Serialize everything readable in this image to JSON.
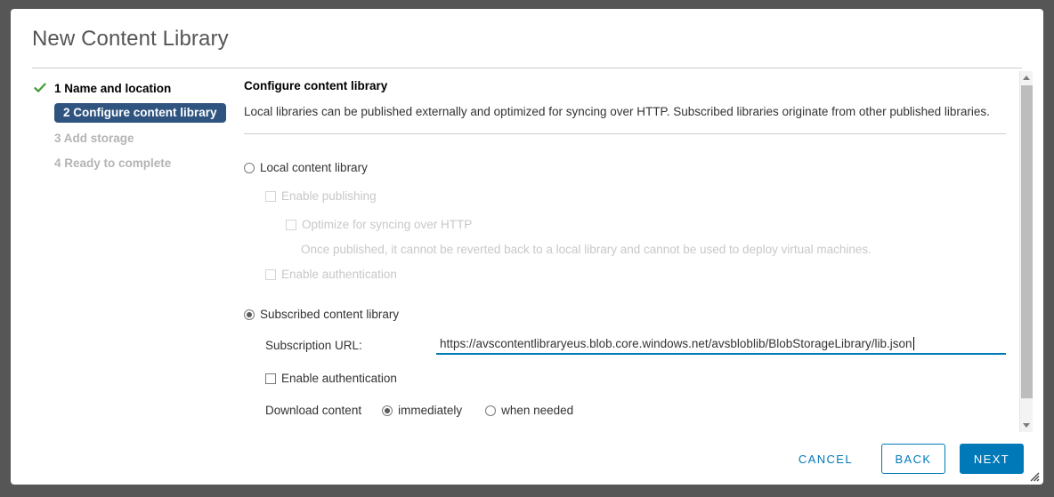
{
  "dialog": {
    "title": "New Content Library"
  },
  "steps": [
    {
      "label": "1 Name and location",
      "state": "done",
      "check_icon": "check-icon"
    },
    {
      "label": "2 Configure content library",
      "state": "current"
    },
    {
      "label": "3 Add storage",
      "state": "pending"
    },
    {
      "label": "4 Ready to complete",
      "state": "pending"
    }
  ],
  "section": {
    "title": "Configure content library",
    "description": "Local libraries can be published externally and optimized for syncing over HTTP. Subscribed libraries originate from other published libraries."
  },
  "local": {
    "radio_label": "Local content library",
    "selected": false,
    "enable_publishing_label": "Enable publishing",
    "enable_publishing_checked": false,
    "optimize_label": "Optimize for syncing over HTTP",
    "optimize_checked": false,
    "optimize_note": "Once published, it cannot be reverted back to a local library and cannot be used to deploy virtual machines.",
    "enable_authentication_label": "Enable authentication",
    "enable_authentication_checked": false
  },
  "subscribed": {
    "radio_label": "Subscribed content library",
    "selected": true,
    "url_label": "Subscription URL:",
    "url_value": "https://avscontentlibraryeus.blob.core.windows.net/avsbloblib/BlobStorageLibrary/lib.json",
    "url_placeholder": "",
    "enable_authentication_label": "Enable authentication",
    "enable_authentication_checked": false,
    "download_label": "Download content",
    "download_options": [
      {
        "label": "immediately",
        "selected": true
      },
      {
        "label": "when needed",
        "selected": false
      }
    ]
  },
  "scrollbar": {
    "up_icon": "chevron-up-icon",
    "down_icon": "chevron-down-icon"
  },
  "footer": {
    "cancel_label": "CANCEL",
    "back_label": "BACK",
    "next_label": "NEXT"
  },
  "colors": {
    "accent_blue": "#0079b8",
    "step_pill_navy": "#2f5480",
    "check_green": "#3f9c35",
    "backdrop": "#565656",
    "disabled_text": "#c8c8c8"
  }
}
